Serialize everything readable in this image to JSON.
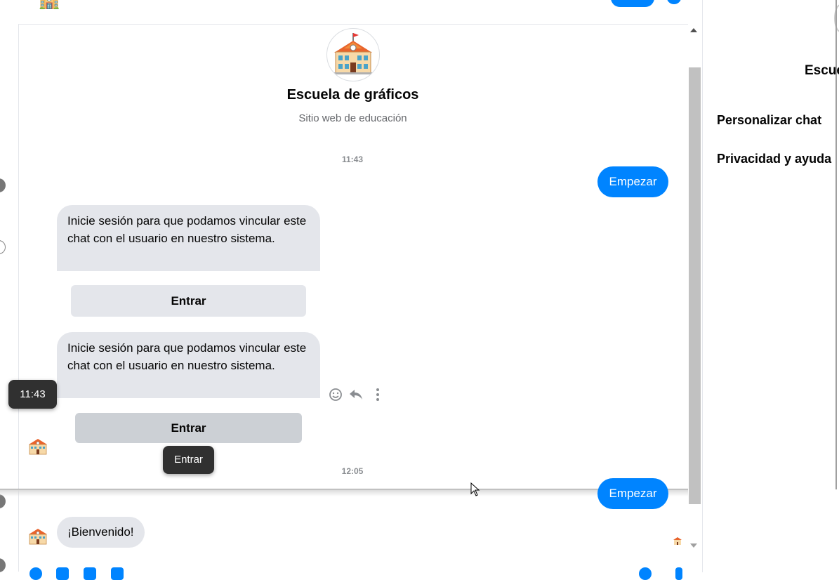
{
  "page": {
    "name": "Escuela de gráficos",
    "subtitle": "Sitio web de educación"
  },
  "messages": {
    "timestamp_1": "11:43",
    "start_1": "Empezar",
    "bot_msg_1": "Inicie sesión para que podamos vincular este chat con el usuario en nuestro sistema.",
    "button_1": "Entrar",
    "bot_msg_2": "Inicie sesión para que podamos vincular este chat con el usuario en nuestro sistema.",
    "button_2": "Entrar",
    "timestamp_2": "12:05",
    "start_2": "Empezar",
    "welcome": "¡Bienvenido!"
  },
  "tooltips": {
    "time": "11:43",
    "button": "Entrar"
  },
  "right_panel": {
    "title_partial": "Escue",
    "items": [
      "Personalizar chat",
      "Privacidad y ayuda"
    ]
  },
  "colors": {
    "accent": "#0084ff",
    "incoming_bubble": "#e4e6eb",
    "tooltip_bg": "#303030"
  },
  "icons": [
    "school-avatar-icon",
    "emoji-react-icon",
    "reply-icon",
    "more-options-icon"
  ]
}
